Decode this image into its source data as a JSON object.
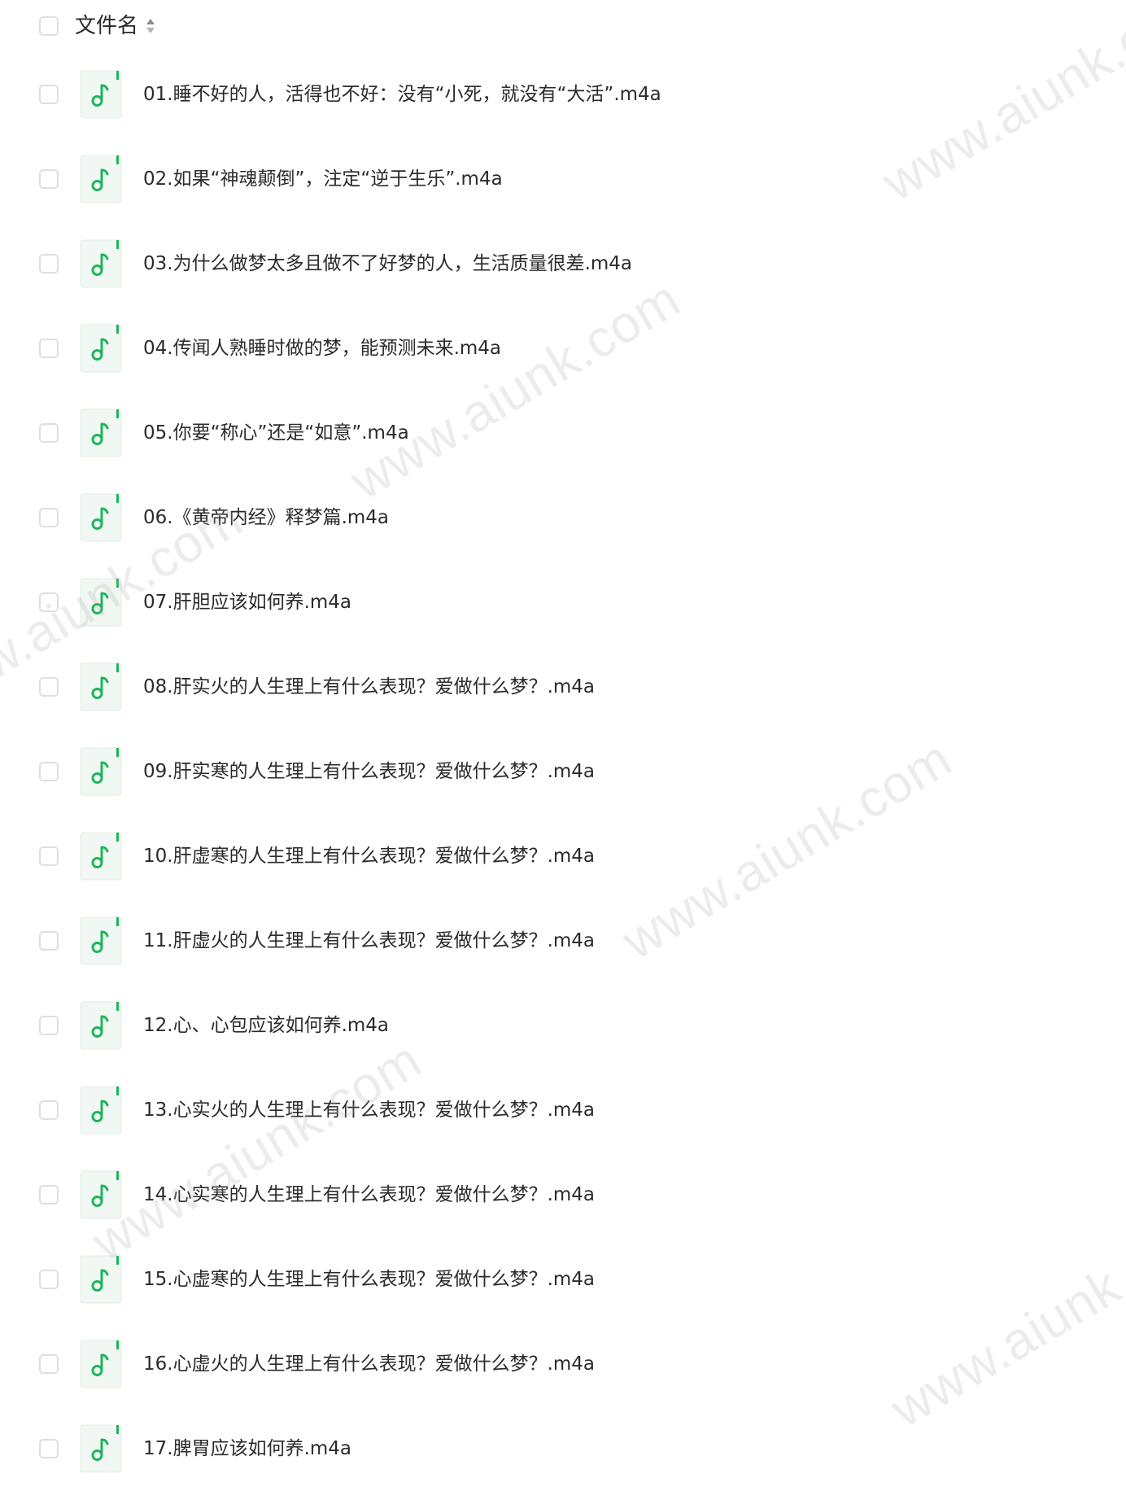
{
  "header": {
    "title": "文件名"
  },
  "files": [
    {
      "name": "01.睡不好的人，活得也不好：没有“小死，就没有“大活”.m4a"
    },
    {
      "name": "02.如果“神魂颠倒”，注定“逆于生乐”.m4a"
    },
    {
      "name": "03.为什么做梦太多且做不了好梦的人，生活质量很差.m4a"
    },
    {
      "name": "04.传闻人熟睡时做的梦，能预测未来.m4a"
    },
    {
      "name": "05.你要“称心”还是“如意”.m4a"
    },
    {
      "name": "06.《黄帝内经》释梦篇.m4a"
    },
    {
      "name": "07.肝胆应该如何养.m4a"
    },
    {
      "name": "08.肝实火的人生理上有什么表现？爱做什么梦？.m4a"
    },
    {
      "name": "09.肝实寒的人生理上有什么表现？爱做什么梦？.m4a"
    },
    {
      "name": "10.肝虚寒的人生理上有什么表现？爱做什么梦？.m4a"
    },
    {
      "name": "11.肝虚火的人生理上有什么表现？爱做什么梦？.m4a"
    },
    {
      "name": "12.心、心包应该如何养.m4a"
    },
    {
      "name": "13.心实火的人生理上有什么表现？爱做什么梦？.m4a"
    },
    {
      "name": "14.心实寒的人生理上有什么表现？爱做什么梦？.m4a"
    },
    {
      "name": "15.心虚寒的人生理上有什么表现？爱做什么梦？.m4a"
    },
    {
      "name": "16.心虚火的人生理上有什么表现？爱做什么梦？.m4a"
    },
    {
      "name": "17.脾胃应该如何养.m4a"
    }
  ],
  "watermark": "www.aiunk.com",
  "colors": {
    "accent": "#1fb55a",
    "icon_bg": "#f1f8f3",
    "checkbox_border": "#dcdfe4",
    "text": "#2b2b2b"
  },
  "icons": {
    "file": "music-file-icon",
    "sort": "sort-icon"
  }
}
